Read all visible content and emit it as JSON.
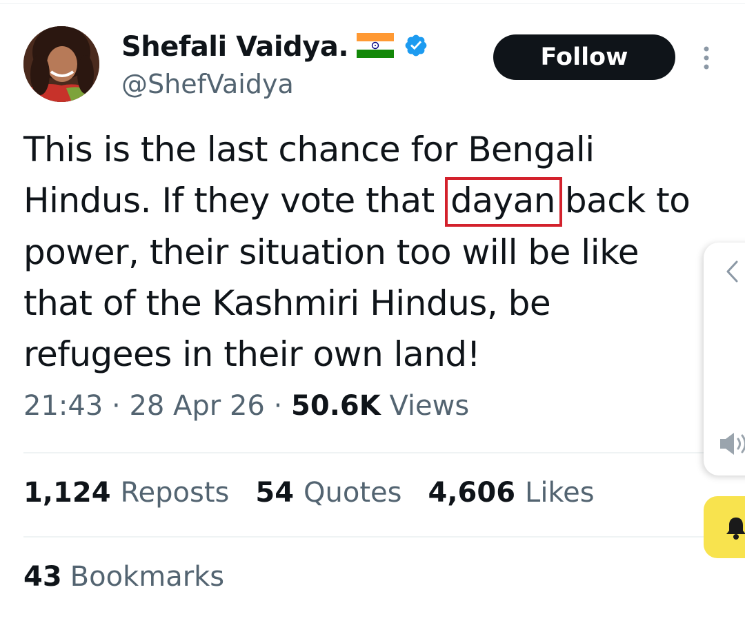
{
  "author": {
    "display_name": "Shefali Vaidya.",
    "handle": "@ShefVaidya"
  },
  "actions": {
    "follow_label": "Follow"
  },
  "tweet": {
    "text_before": "This is the last chance for Bengali Hindus. If they vote that ",
    "highlighted_word": "dayan",
    "text_after": "back to power, their situation too will be like that of the Kashmiri Hindus, be refugees in their own land!",
    "highlight_color": "#d3212c"
  },
  "meta": {
    "time": "21:43",
    "sep1": " · ",
    "date": "28 Apr 26",
    "sep2": " · ",
    "views_count": "50.6K",
    "views_label": "Views"
  },
  "stats": {
    "reposts_count": "1,124",
    "reposts_label": "Reposts",
    "quotes_count": "54",
    "quotes_label": "Quotes",
    "likes_count": "4,606",
    "likes_label": "Likes",
    "bookmarks_count": "43",
    "bookmarks_label": "Bookmarks"
  },
  "icons": {
    "flag": "india-flag-icon",
    "verified": "verified-badge-icon",
    "more": "more-options-icon",
    "chevron": "chevron-left-icon",
    "volume": "volume-icon",
    "bell": "bell-icon"
  },
  "colors": {
    "verified_blue": "#1d9bf0",
    "follow_bg": "#0f1419",
    "secondary_text": "#536471",
    "bell_bg": "#f8e34e"
  }
}
